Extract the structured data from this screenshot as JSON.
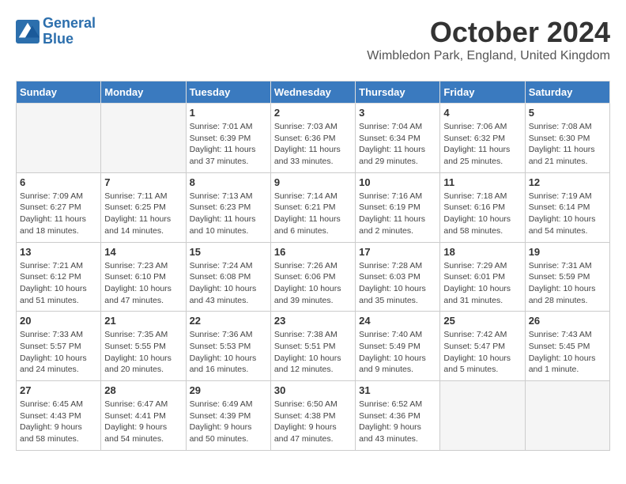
{
  "app": {
    "name_line1": "General",
    "name_line2": "Blue"
  },
  "header": {
    "month": "October 2024",
    "location": "Wimbledon Park, England, United Kingdom"
  },
  "weekdays": [
    "Sunday",
    "Monday",
    "Tuesday",
    "Wednesday",
    "Thursday",
    "Friday",
    "Saturday"
  ],
  "weeks": [
    [
      {
        "day": "",
        "info": ""
      },
      {
        "day": "",
        "info": ""
      },
      {
        "day": "1",
        "info": "Sunrise: 7:01 AM\nSunset: 6:39 PM\nDaylight: 11 hours and 37 minutes."
      },
      {
        "day": "2",
        "info": "Sunrise: 7:03 AM\nSunset: 6:36 PM\nDaylight: 11 hours and 33 minutes."
      },
      {
        "day": "3",
        "info": "Sunrise: 7:04 AM\nSunset: 6:34 PM\nDaylight: 11 hours and 29 minutes."
      },
      {
        "day": "4",
        "info": "Sunrise: 7:06 AM\nSunset: 6:32 PM\nDaylight: 11 hours and 25 minutes."
      },
      {
        "day": "5",
        "info": "Sunrise: 7:08 AM\nSunset: 6:30 PM\nDaylight: 11 hours and 21 minutes."
      }
    ],
    [
      {
        "day": "6",
        "info": "Sunrise: 7:09 AM\nSunset: 6:27 PM\nDaylight: 11 hours and 18 minutes."
      },
      {
        "day": "7",
        "info": "Sunrise: 7:11 AM\nSunset: 6:25 PM\nDaylight: 11 hours and 14 minutes."
      },
      {
        "day": "8",
        "info": "Sunrise: 7:13 AM\nSunset: 6:23 PM\nDaylight: 11 hours and 10 minutes."
      },
      {
        "day": "9",
        "info": "Sunrise: 7:14 AM\nSunset: 6:21 PM\nDaylight: 11 hours and 6 minutes."
      },
      {
        "day": "10",
        "info": "Sunrise: 7:16 AM\nSunset: 6:19 PM\nDaylight: 11 hours and 2 minutes."
      },
      {
        "day": "11",
        "info": "Sunrise: 7:18 AM\nSunset: 6:16 PM\nDaylight: 10 hours and 58 minutes."
      },
      {
        "day": "12",
        "info": "Sunrise: 7:19 AM\nSunset: 6:14 PM\nDaylight: 10 hours and 54 minutes."
      }
    ],
    [
      {
        "day": "13",
        "info": "Sunrise: 7:21 AM\nSunset: 6:12 PM\nDaylight: 10 hours and 51 minutes."
      },
      {
        "day": "14",
        "info": "Sunrise: 7:23 AM\nSunset: 6:10 PM\nDaylight: 10 hours and 47 minutes."
      },
      {
        "day": "15",
        "info": "Sunrise: 7:24 AM\nSunset: 6:08 PM\nDaylight: 10 hours and 43 minutes."
      },
      {
        "day": "16",
        "info": "Sunrise: 7:26 AM\nSunset: 6:06 PM\nDaylight: 10 hours and 39 minutes."
      },
      {
        "day": "17",
        "info": "Sunrise: 7:28 AM\nSunset: 6:03 PM\nDaylight: 10 hours and 35 minutes."
      },
      {
        "day": "18",
        "info": "Sunrise: 7:29 AM\nSunset: 6:01 PM\nDaylight: 10 hours and 31 minutes."
      },
      {
        "day": "19",
        "info": "Sunrise: 7:31 AM\nSunset: 5:59 PM\nDaylight: 10 hours and 28 minutes."
      }
    ],
    [
      {
        "day": "20",
        "info": "Sunrise: 7:33 AM\nSunset: 5:57 PM\nDaylight: 10 hours and 24 minutes."
      },
      {
        "day": "21",
        "info": "Sunrise: 7:35 AM\nSunset: 5:55 PM\nDaylight: 10 hours and 20 minutes."
      },
      {
        "day": "22",
        "info": "Sunrise: 7:36 AM\nSunset: 5:53 PM\nDaylight: 10 hours and 16 minutes."
      },
      {
        "day": "23",
        "info": "Sunrise: 7:38 AM\nSunset: 5:51 PM\nDaylight: 10 hours and 12 minutes."
      },
      {
        "day": "24",
        "info": "Sunrise: 7:40 AM\nSunset: 5:49 PM\nDaylight: 10 hours and 9 minutes."
      },
      {
        "day": "25",
        "info": "Sunrise: 7:42 AM\nSunset: 5:47 PM\nDaylight: 10 hours and 5 minutes."
      },
      {
        "day": "26",
        "info": "Sunrise: 7:43 AM\nSunset: 5:45 PM\nDaylight: 10 hours and 1 minute."
      }
    ],
    [
      {
        "day": "27",
        "info": "Sunrise: 6:45 AM\nSunset: 4:43 PM\nDaylight: 9 hours and 58 minutes."
      },
      {
        "day": "28",
        "info": "Sunrise: 6:47 AM\nSunset: 4:41 PM\nDaylight: 9 hours and 54 minutes."
      },
      {
        "day": "29",
        "info": "Sunrise: 6:49 AM\nSunset: 4:39 PM\nDaylight: 9 hours and 50 minutes."
      },
      {
        "day": "30",
        "info": "Sunrise: 6:50 AM\nSunset: 4:38 PM\nDaylight: 9 hours and 47 minutes."
      },
      {
        "day": "31",
        "info": "Sunrise: 6:52 AM\nSunset: 4:36 PM\nDaylight: 9 hours and 43 minutes."
      },
      {
        "day": "",
        "info": ""
      },
      {
        "day": "",
        "info": ""
      }
    ]
  ]
}
